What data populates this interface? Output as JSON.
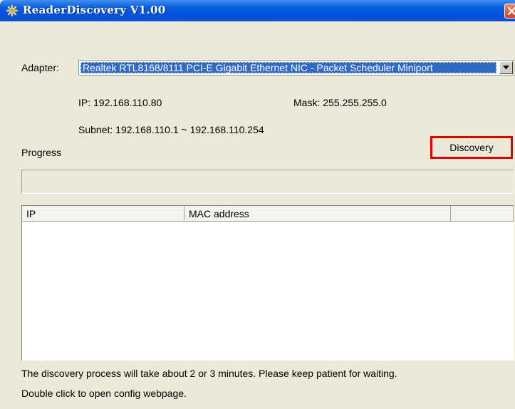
{
  "window": {
    "title": "ReaderDiscovery V1.00",
    "app_icon": "network-icon",
    "close_icon": "close-icon"
  },
  "adapter": {
    "label": "Adapter:",
    "selected": "Realtek RTL8168/8111 PCI-E Gigabit Ethernet NIC - Packet Scheduler Miniport",
    "dropdown_icon": "chevron-down-icon"
  },
  "network": {
    "ip": "IP: 192.168.110.80",
    "mask": "Mask: 255.255.255.0",
    "subnet": "Subnet: 192.168.110.1 ~ 192.168.110.254"
  },
  "progress": {
    "label": "Progress",
    "value": 0
  },
  "discovery_button": {
    "label": "Discovery"
  },
  "results_table": {
    "columns": [
      "IP",
      "MAC address",
      ""
    ],
    "rows": []
  },
  "footer": {
    "line1": "The discovery process will take about 2 or 3 minutes. Please keep patient for waiting.",
    "line2": "Double click to open config webpage."
  },
  "colors": {
    "selection": "#316ac5",
    "highlight_border": "#e00000",
    "titlebar": "#0054e3"
  }
}
